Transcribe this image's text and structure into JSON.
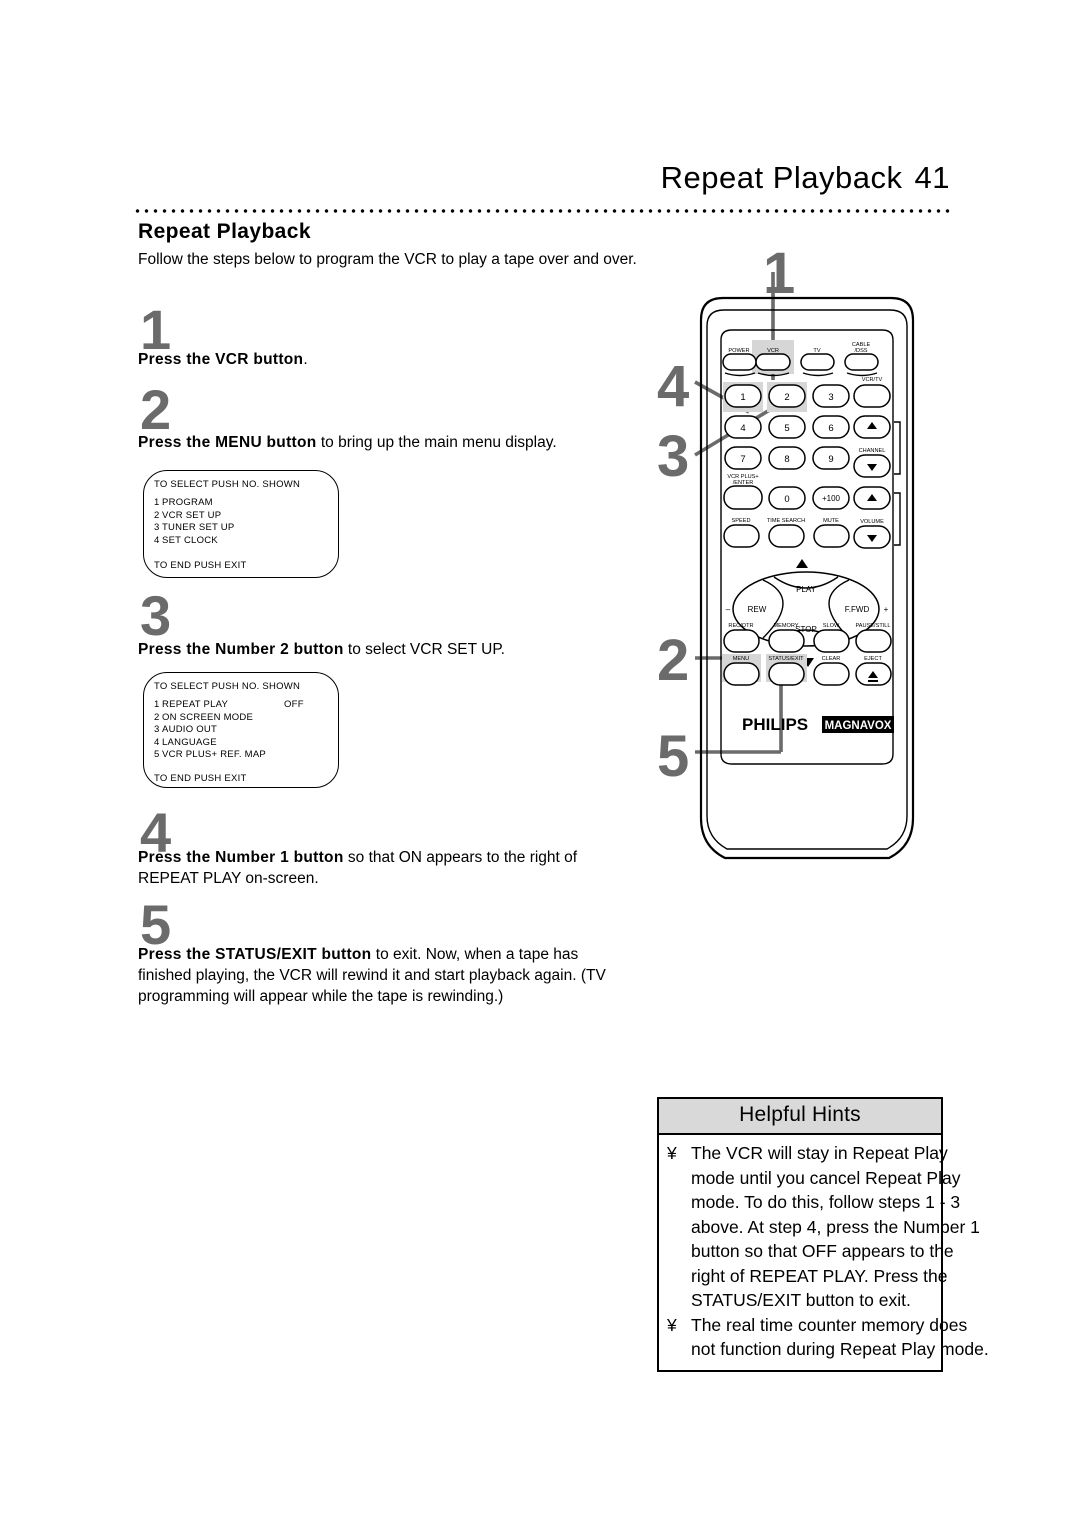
{
  "header": {
    "title": "Repeat Playback",
    "page_number": "41"
  },
  "section": {
    "title": "Repeat Playback",
    "intro": "Follow the steps below to program the VCR to play a tape over and over."
  },
  "steps": [
    {
      "number": "1",
      "bold": "Press the VCR button",
      "rest": "."
    },
    {
      "number": "2",
      "bold": "Press the MENU button",
      "rest": " to bring up the main menu display."
    },
    {
      "number": "3",
      "bold": "Press the Number 2 button",
      "rest": " to select VCR SET UP."
    },
    {
      "number": "4",
      "bold": "Press the Number 1 button",
      "rest": " so that ON appears to the right of REPEAT PLAY on-screen."
    },
    {
      "number": "5",
      "bold": "Press the STATUS/EXIT button",
      "rest": " to exit. Now, when a tape has finished playing, the VCR will rewind it and start playback again. (TV programming will appear while the tape is rewinding.)"
    }
  ],
  "osd_main_menu": {
    "header": "TO SELECT PUSH NO. SHOWN",
    "items": [
      {
        "index": "1",
        "label": "PROGRAM",
        "value": ""
      },
      {
        "index": "2",
        "label": "VCR SET UP",
        "value": ""
      },
      {
        "index": "3",
        "label": "TUNER SET UP",
        "value": ""
      },
      {
        "index": "4",
        "label": "SET CLOCK",
        "value": ""
      }
    ],
    "footer": "TO END PUSH EXIT"
  },
  "osd_vcr_setup": {
    "header": "TO SELECT PUSH NO. SHOWN",
    "items": [
      {
        "index": "1",
        "label": "REPEAT PLAY",
        "value": "OFF"
      },
      {
        "index": "2",
        "label": "ON SCREEN MODE",
        "value": ""
      },
      {
        "index": "3",
        "label": "AUDIO OUT",
        "value": ""
      },
      {
        "index": "4",
        "label": "LANGUAGE",
        "value": ""
      },
      {
        "index": "5",
        "label": "VCR PLUS+ REF. MAP",
        "value": ""
      }
    ],
    "footer": "TO END PUSH EXIT"
  },
  "remote": {
    "callouts": [
      "1",
      "2",
      "3",
      "4",
      "5"
    ],
    "brand_primary": "PHILIPS",
    "brand_secondary": "MAGNAVOX",
    "row_mode": [
      "POWER",
      "VCR",
      "TV",
      "CABLE /DSS"
    ],
    "row_mode_lines": {
      "cable_line1": "CABLE",
      "cable_line2": "/DSS"
    },
    "keypad": [
      "1",
      "2",
      "3",
      "4",
      "5",
      "6",
      "7",
      "8",
      "9",
      "0",
      "+100"
    ],
    "vcr_tv_label": "VCR/TV",
    "channel_label": "CHANNEL",
    "volume_label": "VOLUME",
    "vcr_plus_line1": "VCR PLUS+",
    "vcr_plus_line2": "/ENTER",
    "row_func": [
      "SPEED",
      "TIME SEARCH",
      "MUTE"
    ],
    "transport": {
      "play": "PLAY",
      "stop": "STOP",
      "rew": "REW",
      "ffwd": "F.FWD",
      "minus": "–",
      "plus": "+"
    },
    "row_rec": [
      "REC/OTR",
      "MEMORY",
      "SLOW",
      "PAUSE/STILL"
    ],
    "row_menu": [
      "MENU",
      "STATUS/EXIT",
      "CLEAR",
      "EJECT"
    ],
    "highlight_color": "#d6d6d6",
    "callout_color": "#6b6b6b"
  },
  "hints": {
    "title": "Helpful Hints",
    "bullet": "¥",
    "items": [
      "The VCR will stay in Repeat Play mode until you cancel Repeat Play mode. To do this, follow steps 1 - 3 above. At step 4, press the Number 1 button so that OFF appears to the right of REPEAT PLAY. Press the STATUS/EXIT button to exit.",
      "The real time counter memory does not function during Repeat Play mode."
    ]
  }
}
